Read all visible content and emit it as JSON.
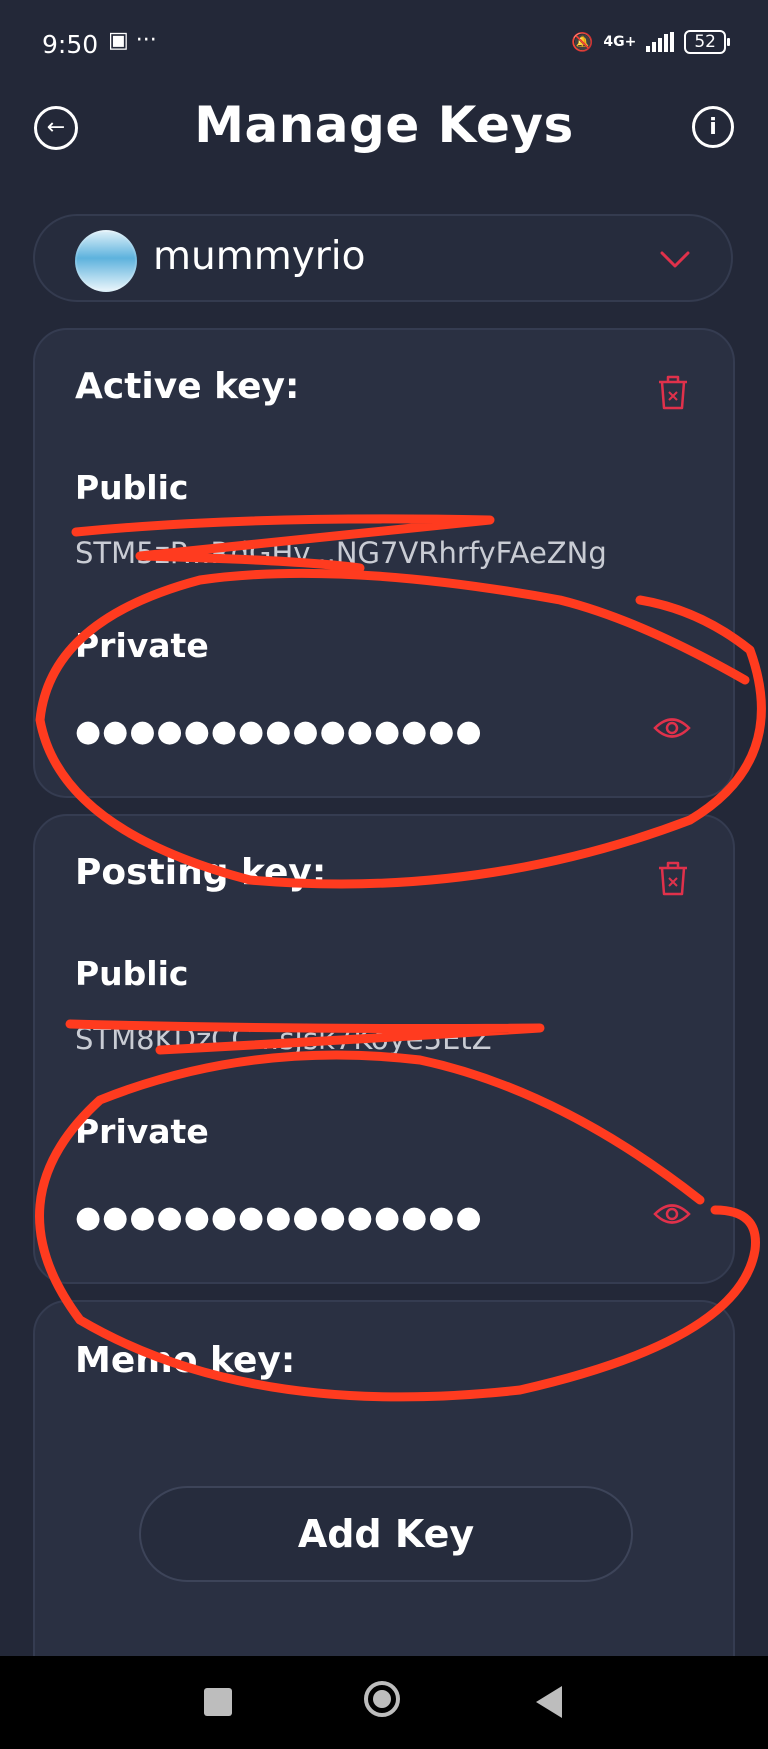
{
  "status": {
    "time": "9:50",
    "network": "4G+",
    "battery": "52"
  },
  "header": {
    "title": "Manage Keys"
  },
  "account": {
    "name": "mummyrio"
  },
  "active_key": {
    "title": "Active key:",
    "public_label": "Public",
    "public_value": "STM5zP...RdGHv...NG7VRhrfyFAeZNg",
    "private_label": "Private",
    "private_value": "●●●●●●●●●●●●●●●"
  },
  "posting_key": {
    "title": "Posting key:",
    "public_label": "Public",
    "public_value": "STM8KDzCC...sJsk7Koye5EtZ",
    "private_label": "Private",
    "private_value": "●●●●●●●●●●●●●●●"
  },
  "memo_key": {
    "title": "Memo key:",
    "add_button": "Add Key"
  },
  "colors": {
    "background": "#232838",
    "card": "#2a3042",
    "accent_red": "#e0314b",
    "annotation": "#ff3b1f"
  }
}
